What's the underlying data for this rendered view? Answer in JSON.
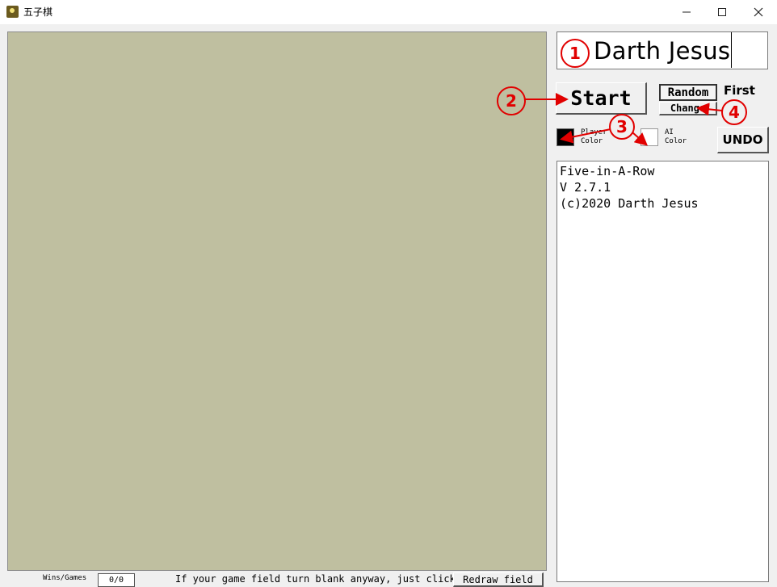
{
  "window": {
    "title": "五子棋",
    "minimize_glyph": "—",
    "maximize_glyph": "☐",
    "close_glyph": "✕"
  },
  "player_name": "Darth Jesus",
  "controls": {
    "start_label": "Start",
    "random_label": "Random",
    "first_label": "First",
    "change_label": "Change",
    "player_color_label_1": "Player",
    "player_color_label_2": "Color",
    "ai_color_label_1": "AI",
    "ai_color_label_2": "Color",
    "undo_label": "UNDO"
  },
  "info": {
    "line1": "Five-in-A-Row",
    "line2": "V 2.7.1",
    "line3": "(c)2020 Darth Jesus"
  },
  "status": {
    "wins_games_label": "Wins/Games",
    "wins_games_value": "0/0",
    "blank_hint": "If your game field turn blank anyway, just click",
    "redraw_label": "Redraw field"
  },
  "annotations": [
    "1",
    "2",
    "3",
    "4"
  ],
  "colors": {
    "board": "#bfbfa0",
    "player_stone": "#000000",
    "ai_stone": "#ffffff",
    "annotation": "#e10000"
  }
}
